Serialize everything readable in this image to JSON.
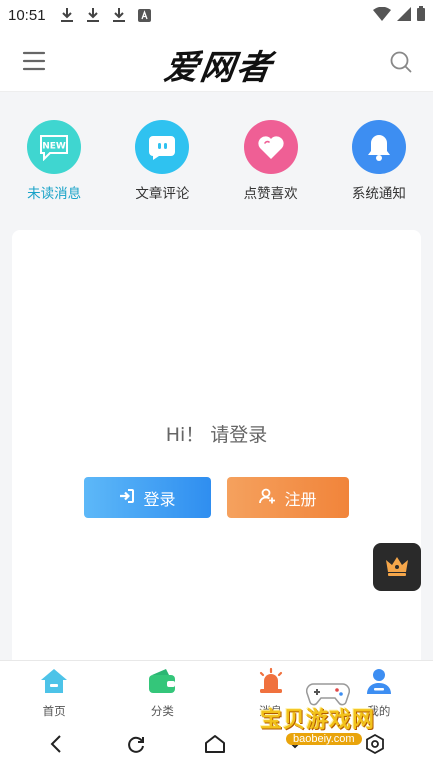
{
  "status_bar": {
    "time": "10:51",
    "left_icons": [
      "download-icon",
      "download-icon",
      "download-icon",
      "a-box-icon"
    ],
    "right_icons": [
      "wifi-icon",
      "signal-icon",
      "battery-icon"
    ]
  },
  "header": {
    "logo_text": "爱网者",
    "menu_icon": "menu-icon",
    "search_icon": "search-icon"
  },
  "quick_nav": [
    {
      "label": "未读消息",
      "icon": "new-badge-icon",
      "color": "#3fd6d0",
      "active": true
    },
    {
      "label": "文章评论",
      "icon": "chat-bubble-icon",
      "color": "#2fc2f0",
      "active": false
    },
    {
      "label": "点赞喜欢",
      "icon": "heart-icon",
      "color": "#ef5f95",
      "active": false
    },
    {
      "label": "系统通知",
      "icon": "bell-icon",
      "color": "#3d8ef2",
      "active": false
    }
  ],
  "login_card": {
    "greeting": "Hi！ 请登录",
    "login_label": "登录",
    "register_label": "注册",
    "login_color": "#3a98f2",
    "register_color": "#f28c45"
  },
  "floating_button": {
    "icon": "crown-icon"
  },
  "tab_bar": [
    {
      "label": "首页",
      "icon": "home-icon"
    },
    {
      "label": "分类",
      "icon": "wallet-icon"
    },
    {
      "label": "消息",
      "icon": "alarm-icon"
    },
    {
      "label": "我的",
      "icon": "user-icon"
    }
  ],
  "system_nav": [
    "back-icon",
    "refresh-icon",
    "home-outline-icon",
    "collapse-icon",
    "settings-icon"
  ],
  "watermark": {
    "title": "宝贝游戏网",
    "url": "baobeiy.com"
  }
}
